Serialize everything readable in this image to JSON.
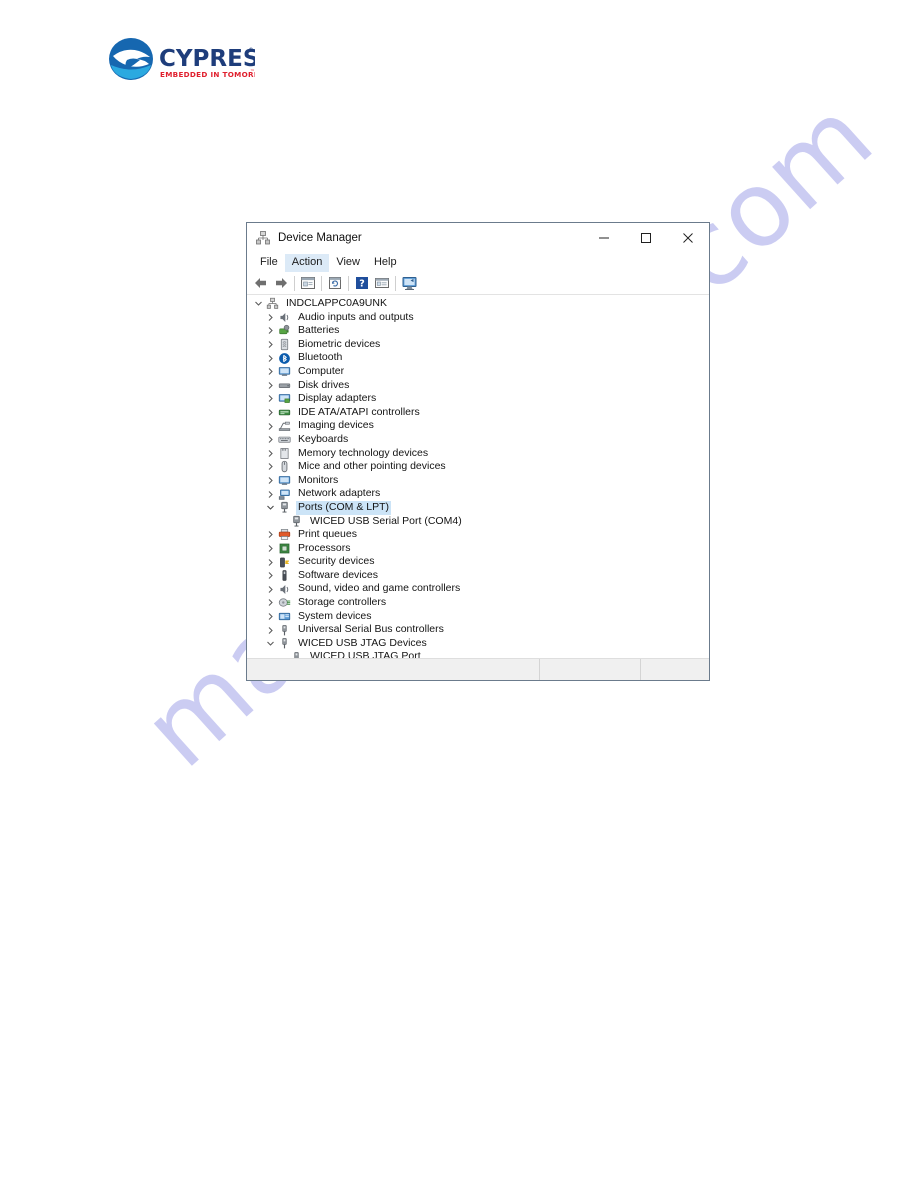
{
  "page": {
    "background_color": "#ffffff",
    "watermark": {
      "text": "manualshive.com",
      "color": "#c9caf2"
    }
  },
  "logo": {
    "name": "cypress-logo",
    "wordmark": "CYPRESS",
    "tagline": "EMBEDDED IN TOMORROW",
    "trademark": "™",
    "wordmark_color": "#1e3d7b",
    "tagline_color": "#e0202e",
    "mark_color": "#1667b0",
    "mark_accent_color": "#2ba9e0"
  },
  "window": {
    "title": "Device Manager",
    "title_icon": "device-manager-icon",
    "controls": [
      {
        "name": "minimize-button",
        "glyph": "—"
      },
      {
        "name": "maximize-button",
        "glyph": "□"
      },
      {
        "name": "close-button",
        "glyph": "✕"
      }
    ],
    "menu": [
      {
        "label": "File",
        "name": "menu-file",
        "active": false
      },
      {
        "label": "Action",
        "name": "menu-action",
        "active": true
      },
      {
        "label": "View",
        "name": "menu-view",
        "active": false
      },
      {
        "label": "Help",
        "name": "menu-help",
        "active": false
      }
    ],
    "toolbar": [
      {
        "name": "back-button",
        "icon": "back-arrow-icon"
      },
      {
        "name": "forward-button",
        "icon": "forward-arrow-icon"
      },
      {
        "name": "separator-1",
        "icon": "separator"
      },
      {
        "name": "properties-button",
        "icon": "properties-window-icon"
      },
      {
        "name": "separator-2",
        "icon": "separator"
      },
      {
        "name": "update-driver-button",
        "icon": "update-driver-icon"
      },
      {
        "name": "separator-3",
        "icon": "separator"
      },
      {
        "name": "help-button",
        "icon": "help-question-icon"
      },
      {
        "name": "scan-hardware-button",
        "icon": "scan-hardware-icon"
      },
      {
        "name": "separator-4",
        "icon": "separator"
      },
      {
        "name": "show-hidden-devices-button",
        "icon": "monitor-scan-icon"
      }
    ],
    "status_bar": {
      "panel_1": "",
      "panel_2": "",
      "panel_3": ""
    }
  },
  "tree": {
    "selection_color": "#cce4f7",
    "rows": [
      {
        "label": "INDCLAPPC0A9UNK",
        "level": 0,
        "expander": "expanded",
        "icon": "computer-tree-root-icon",
        "selected": false
      },
      {
        "label": "Audio inputs and outputs",
        "level": 1,
        "expander": "collapsed",
        "icon": "speaker-icon",
        "selected": false
      },
      {
        "label": "Batteries",
        "level": 1,
        "expander": "collapsed",
        "icon": "battery-icon",
        "selected": false
      },
      {
        "label": "Biometric devices",
        "level": 1,
        "expander": "collapsed",
        "icon": "fingerprint-icon",
        "selected": false
      },
      {
        "label": "Bluetooth",
        "level": 1,
        "expander": "collapsed",
        "icon": "bluetooth-icon",
        "selected": false
      },
      {
        "label": "Computer",
        "level": 1,
        "expander": "collapsed",
        "icon": "monitor-icon",
        "selected": false
      },
      {
        "label": "Disk drives",
        "level": 1,
        "expander": "collapsed",
        "icon": "disk-drive-icon",
        "selected": false
      },
      {
        "label": "Display adapters",
        "level": 1,
        "expander": "collapsed",
        "icon": "display-adapter-icon",
        "selected": false
      },
      {
        "label": "IDE ATA/ATAPI controllers",
        "level": 1,
        "expander": "collapsed",
        "icon": "ide-controller-icon",
        "selected": false
      },
      {
        "label": "Imaging devices",
        "level": 1,
        "expander": "collapsed",
        "icon": "scanner-icon",
        "selected": false
      },
      {
        "label": "Keyboards",
        "level": 1,
        "expander": "collapsed",
        "icon": "keyboard-icon",
        "selected": false
      },
      {
        "label": "Memory technology devices",
        "level": 1,
        "expander": "collapsed",
        "icon": "memory-card-icon",
        "selected": false
      },
      {
        "label": "Mice and other pointing devices",
        "level": 1,
        "expander": "collapsed",
        "icon": "mouse-icon",
        "selected": false
      },
      {
        "label": "Monitors",
        "level": 1,
        "expander": "collapsed",
        "icon": "monitor-icon",
        "selected": false
      },
      {
        "label": "Network adapters",
        "level": 1,
        "expander": "collapsed",
        "icon": "network-adapter-icon",
        "selected": false
      },
      {
        "label": "Ports (COM & LPT)",
        "level": 1,
        "expander": "expanded",
        "icon": "port-icon",
        "selected": true
      },
      {
        "label": "WICED USB Serial Port (COM4)",
        "level": 2,
        "expander": "none",
        "icon": "port-icon",
        "selected": false
      },
      {
        "label": "Print queues",
        "level": 1,
        "expander": "collapsed",
        "icon": "printer-icon",
        "selected": false
      },
      {
        "label": "Processors",
        "level": 1,
        "expander": "collapsed",
        "icon": "processor-icon",
        "selected": false
      },
      {
        "label": "Security devices",
        "level": 1,
        "expander": "collapsed",
        "icon": "security-key-icon",
        "selected": false
      },
      {
        "label": "Software devices",
        "level": 1,
        "expander": "collapsed",
        "icon": "software-device-icon",
        "selected": false
      },
      {
        "label": "Sound, video and game controllers",
        "level": 1,
        "expander": "collapsed",
        "icon": "speaker-icon",
        "selected": false
      },
      {
        "label": "Storage controllers",
        "level": 1,
        "expander": "collapsed",
        "icon": "storage-controller-icon",
        "selected": false
      },
      {
        "label": "System devices",
        "level": 1,
        "expander": "collapsed",
        "icon": "system-device-icon",
        "selected": false
      },
      {
        "label": "Universal Serial Bus controllers",
        "level": 1,
        "expander": "collapsed",
        "icon": "usb-icon",
        "selected": false
      },
      {
        "label": "WICED USB JTAG Devices",
        "level": 1,
        "expander": "expanded",
        "icon": "usb-icon",
        "selected": false
      },
      {
        "label": "WICED USB JTAG Port",
        "level": 2,
        "expander": "none",
        "icon": "usb-device-icon",
        "selected": false
      }
    ]
  }
}
